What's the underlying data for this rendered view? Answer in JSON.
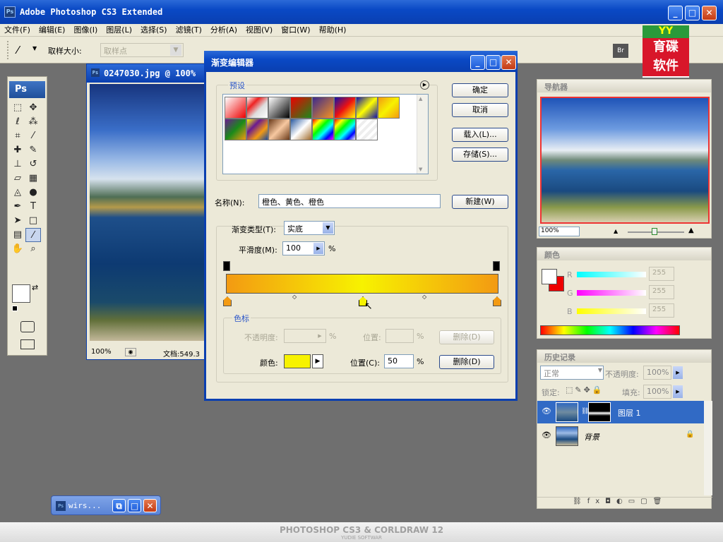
{
  "app": {
    "title": "Adobe Photoshop CS3 Extended",
    "icon": "Ps"
  },
  "menus": [
    "文件(F)",
    "编辑(E)",
    "图像(I)",
    "图层(L)",
    "选择(S)",
    "滤镜(T)",
    "分析(A)",
    "视图(V)",
    "窗口(W)",
    "帮助(H)"
  ],
  "options": {
    "sample_label": "取样大小:",
    "sample_value": "取样点"
  },
  "logo": {
    "line1": "育碟",
    "line2": "软件"
  },
  "toolbox": {
    "title": "Ps"
  },
  "document": {
    "title": "0247030.jpg @ 100%",
    "zoom": "100%",
    "status": "文档:549.3"
  },
  "dialog": {
    "title": "渐变编辑器",
    "presets_label": "预设",
    "ok": "确定",
    "cancel": "取消",
    "load": "载入(L)...",
    "save": "存储(S)...",
    "name_label": "名称(N):",
    "name_value": "橙色、黄色、橙色",
    "new": "新建(W)",
    "type_label": "渐变类型(T):",
    "type_value": "实底",
    "smooth_label": "平滑度(M):",
    "smooth_value": "100",
    "smooth_unit": "%",
    "stops_label": "色标",
    "opacity_label": "不透明度:",
    "opacity_unit": "%",
    "loc_label_top": "位置:",
    "loc_unit_top": "%",
    "delete_top": "删除(D)",
    "color_label": "颜色:",
    "loc_label": "位置(C):",
    "loc_value": "50",
    "loc_unit": "%",
    "delete": "删除(D)",
    "stop_color": "#f7f200",
    "gradient_colors": [
      "#f39a12",
      "#f7f200",
      "#f39a12"
    ]
  },
  "navigator": {
    "title": "导航器",
    "zoom": "100%"
  },
  "color": {
    "title": "颜色",
    "r_label": "R",
    "g_label": "G",
    "b_label": "B",
    "r": "255",
    "g": "255",
    "b": "255"
  },
  "history": {
    "title": "历史记录",
    "blend": "正常",
    "opacity_label": "不透明度:",
    "opacity": "100%",
    "lock_label": "锁定:",
    "fill_label": "填充:",
    "fill": "100%",
    "layers": [
      {
        "name": "图层 1",
        "selected": true
      },
      {
        "name": "背景",
        "selected": false
      }
    ]
  },
  "taskbar": {
    "item": "wirs..."
  },
  "footer": {
    "text": "PHOTOSHOP CS3 & CORLDRAW 12",
    "sub": "YUDIE SOFTWAR"
  }
}
